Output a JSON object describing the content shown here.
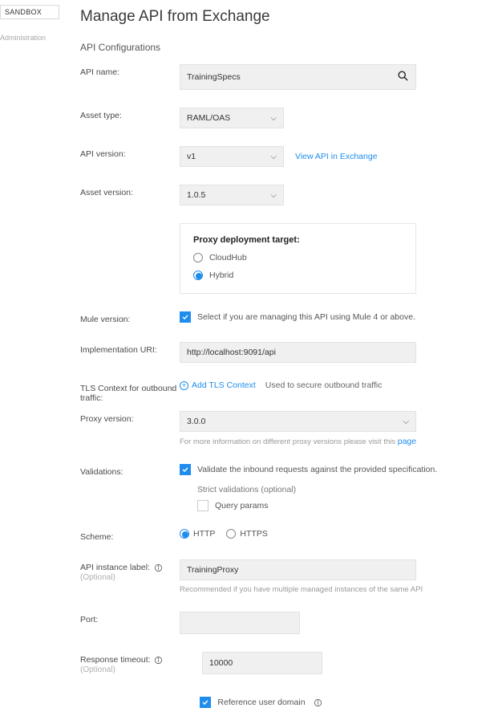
{
  "sidebar": {
    "sandbox_label": "SANDBOX",
    "admin_label": "Administration"
  },
  "page": {
    "title": "Manage API from Exchange",
    "section": "API Configurations"
  },
  "form": {
    "api_name_label": "API name:",
    "api_name_value": "TrainingSpecs",
    "asset_type_label": "Asset type:",
    "asset_type_value": "RAML/OAS",
    "api_version_label": "API version:",
    "api_version_value": "v1",
    "view_in_exchange": "View API in Exchange",
    "asset_version_label": "Asset version:",
    "asset_version_value": "1.0.5",
    "proxy": {
      "heading": "Proxy deployment target:",
      "option_cloudhub": "CloudHub",
      "option_hybrid": "Hybrid"
    },
    "mule_version_label": "Mule version:",
    "mule_version_text": "Select if you are managing this API using Mule 4 or above.",
    "impl_uri_label": "Implementation URI:",
    "impl_uri_value": "http://localhost:9091/api",
    "tls_label": "TLS Context for outbound traffic:",
    "tls_add": "Add TLS Context",
    "tls_hint": "Used to secure outbound traffic",
    "proxy_version_label": "Proxy version:",
    "proxy_version_value": "3.0.0",
    "proxy_version_help_prefix": "For more information on different proxy versions please visit this ",
    "proxy_version_help_link": "page",
    "validations_label": "Validations:",
    "validations_text": "Validate the inbound requests against the provided specification.",
    "strict_heading": "Strict validations (optional)",
    "strict_query": "Query params",
    "scheme_label": "Scheme:",
    "scheme_http": "HTTP",
    "scheme_https": "HTTPS",
    "instance_label": "API instance label:",
    "instance_optional": "(Optional)",
    "instance_value": "TrainingProxy",
    "instance_help": "Recommended if you have multiple managed instances of the same API",
    "port_label": "Port:",
    "port_value": "",
    "timeout_label": "Response timeout:",
    "timeout_optional": "(Optional)",
    "timeout_value": "10000",
    "ref_domain": "Reference user domain"
  }
}
